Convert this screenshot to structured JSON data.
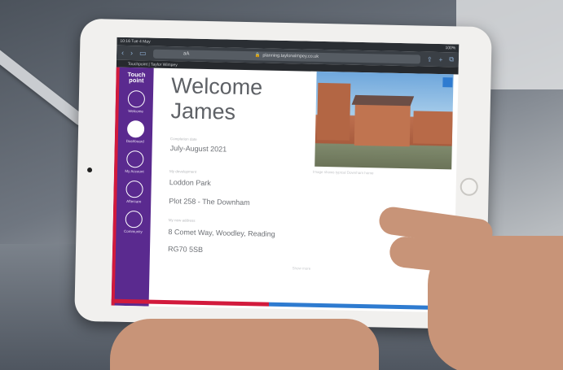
{
  "browser": {
    "status_left": "10:16  Tue 4 May",
    "status_right": "100%",
    "url_prefix": "aA",
    "url": "planning.taylorwimpey.co.uk",
    "tab_title": "Touchpoint | Taylor Wimpey"
  },
  "app": {
    "logo": "Touch point",
    "nav": [
      {
        "label": "Welcome"
      },
      {
        "label": "Dashboard"
      },
      {
        "label": "My Account"
      },
      {
        "label": "Aftercare"
      },
      {
        "label": "Community"
      }
    ],
    "title": "Welcome James",
    "completion_label": "Completion date",
    "completion_value": "July-August 2021",
    "development_label": "My development",
    "development_value": "Loddon Park",
    "plot_value": "Plot 258 - The Downham",
    "address_label": "My new address",
    "address_line1": "8 Comet Way, Woodley, Reading",
    "address_line2": "RG70 5SB",
    "photo_caption": "Image shows typical Downham home",
    "footer_note": "Show more"
  }
}
